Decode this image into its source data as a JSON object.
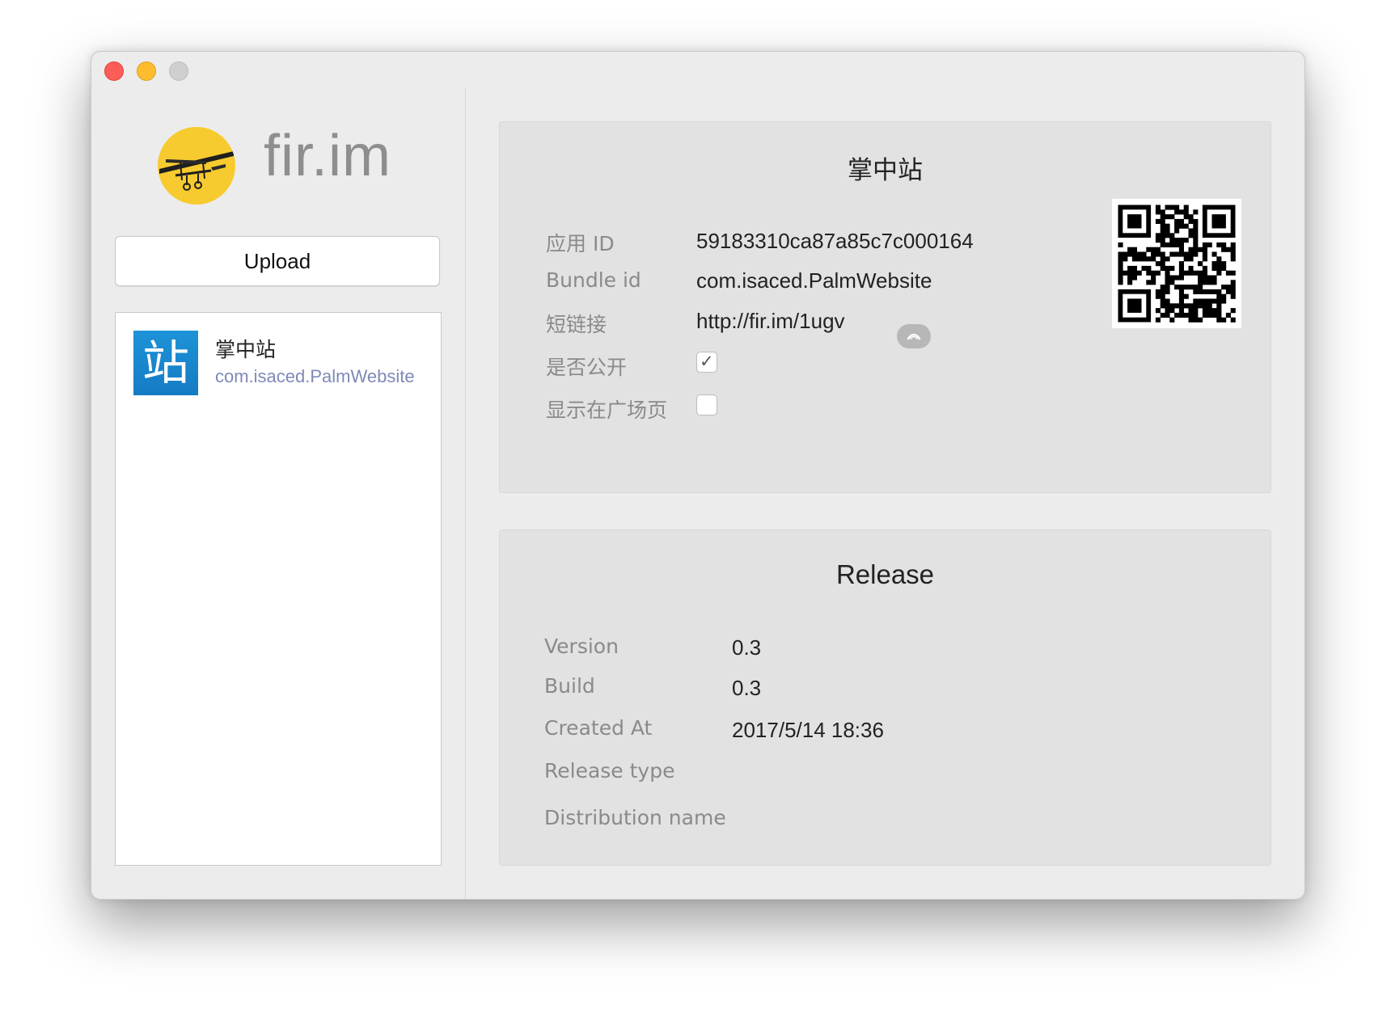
{
  "window": {
    "traffic_lights": [
      "close",
      "minimize",
      "zoom"
    ]
  },
  "sidebar": {
    "logo_text": "fir.im",
    "upload_label": "Upload",
    "apps": [
      {
        "icon_glyph": "站",
        "name": "掌中站",
        "bundle": "com.isaced.PalmWebsite",
        "icon_color": "#1a88d0"
      }
    ]
  },
  "app_panel": {
    "title": "掌中站",
    "app_id_label": "应用 ID",
    "app_id_value": "59183310ca87a85c7c000164",
    "bundle_label": "Bundle id",
    "bundle_value": "com.isaced.PalmWebsite",
    "short_link_label": "短链接",
    "short_link_value": "http://fir.im/1ugv",
    "is_public_label": "是否公开",
    "is_public_checked": true,
    "is_public_mark": "✓",
    "show_in_square_label": "显示在广场页",
    "show_in_square_checked": false
  },
  "release_panel": {
    "title": "Release",
    "version_label": "Version",
    "version_value": "0.3",
    "build_label": "Build",
    "build_value": "0.3",
    "created_label": "Created At",
    "created_value": "2017/5/14 18:36",
    "release_type_label": "Release type",
    "release_type_value": "",
    "distribution_label": "Distribution name",
    "distribution_value": ""
  },
  "colors": {
    "window_bg": "#ececec",
    "panel_bg": "#e2e2e2",
    "logo_yellow": "#f7cb2f",
    "bundle_text": "#7f89b8",
    "label_gray": "#8a8a8a"
  }
}
